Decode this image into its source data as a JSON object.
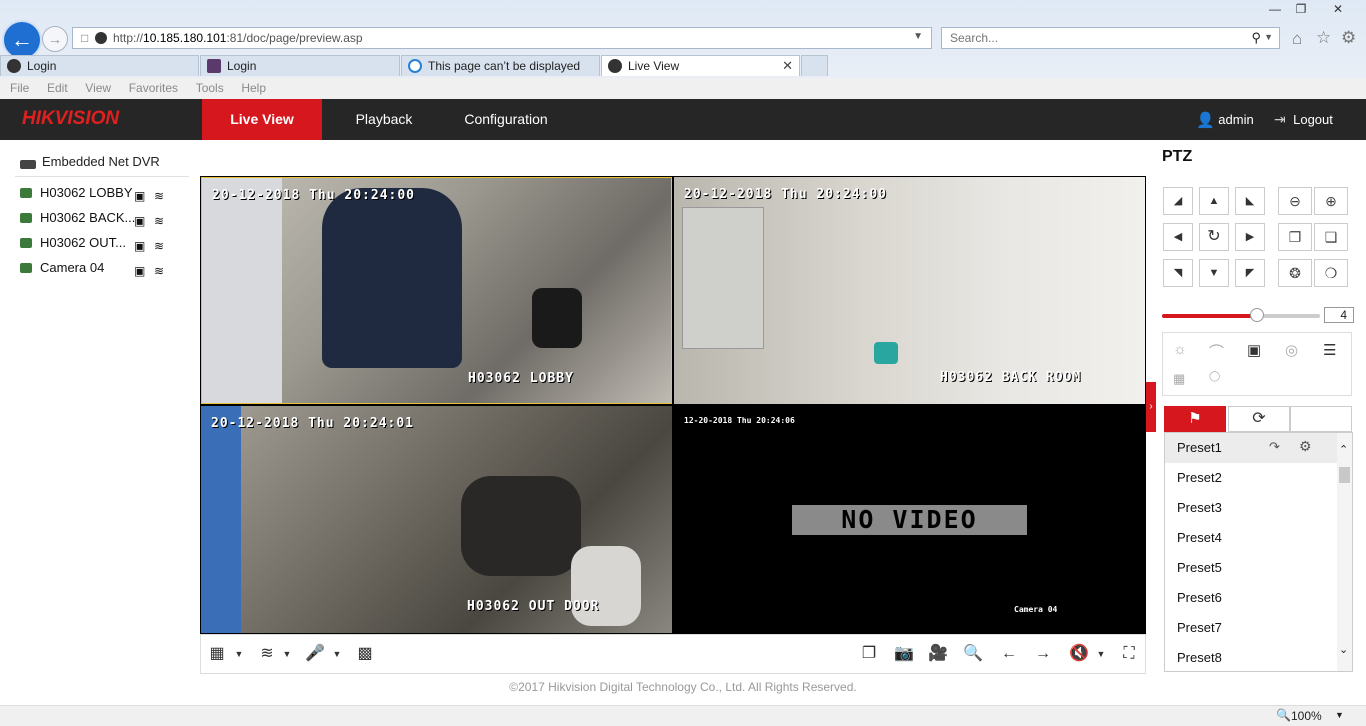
{
  "browser": {
    "url_prefix": "http://",
    "url_host": "10.185.180.101",
    "url_rest": ":81/doc/page/preview.asp",
    "search_placeholder": "Search...",
    "tabs": [
      {
        "label": "Login"
      },
      {
        "label": "Login"
      },
      {
        "label": "This page can’t be displayed"
      },
      {
        "label": "Live View"
      }
    ],
    "menu": [
      "File",
      "Edit",
      "View",
      "Favorites",
      "Tools",
      "Help"
    ],
    "zoom": "100%"
  },
  "app": {
    "brand_red": "HIK",
    "brand_white": "VISION",
    "nav": [
      "Live View",
      "Playback",
      "Configuration"
    ],
    "user": "admin",
    "logout": "Logout",
    "accent_color": "#d6171e"
  },
  "tree": {
    "root": "Embedded Net DVR",
    "cameras": [
      {
        "label": "H03062 LOBBY"
      },
      {
        "label": "H03062 BACK..."
      },
      {
        "label": "H03062 OUT..."
      },
      {
        "label": "Camera 04"
      }
    ]
  },
  "video": [
    {
      "timestamp": "20-12-2018 Thu 20:24:00",
      "name": "H03062 LOBBY"
    },
    {
      "timestamp": "20-12-2018 Thu 20:24:00",
      "name": "H03062 BACK ROOM"
    },
    {
      "timestamp": "20-12-2018 Thu 20:24:01",
      "name": "H03062 OUT DOOR"
    },
    {
      "timestamp": "12-20-2018 Thu 20:24:06",
      "name": "Camera 04",
      "no_video": "NO VIDEO"
    }
  ],
  "ptz": {
    "title": "PTZ",
    "speed": "4",
    "speed_fraction": 0.6,
    "presets": [
      "Preset1",
      "Preset2",
      "Preset3",
      "Preset4",
      "Preset5",
      "Preset6",
      "Preset7",
      "Preset8"
    ]
  },
  "footer": "©2017 Hikvision Digital Technology Co., Ltd. All Rights Reserved."
}
